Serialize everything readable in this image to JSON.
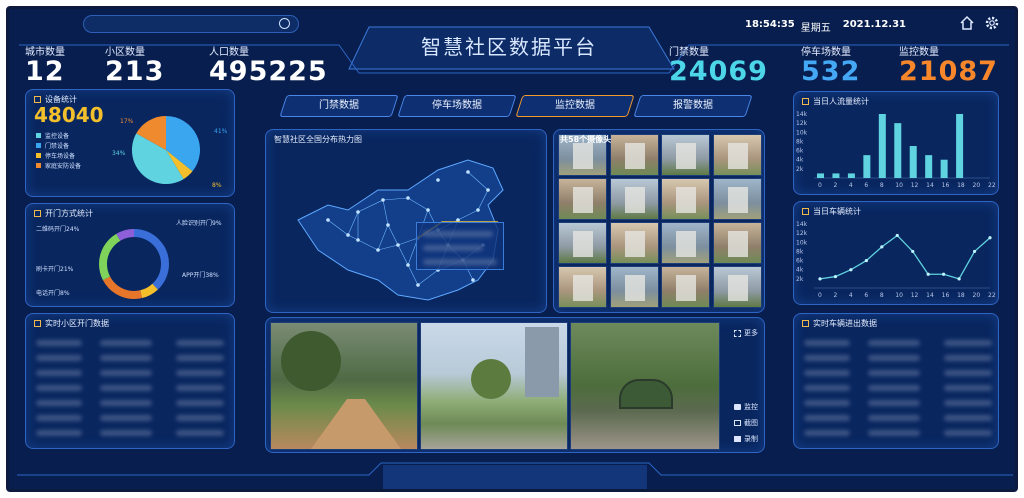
{
  "header": {
    "title": "智慧社区数据平台",
    "time": "18:54:35",
    "weekday": "星期五",
    "date": "2021.12.31"
  },
  "kpis": {
    "city": {
      "label": "城市数量",
      "value": "12"
    },
    "district": {
      "label": "小区数量",
      "value": "213"
    },
    "population": {
      "label": "人口数量",
      "value": "495225"
    },
    "door": {
      "label": "门禁数量",
      "value": "24069",
      "color": "#4cd6e8"
    },
    "parking": {
      "label": "停车场数量",
      "value": "532",
      "color": "#45a8f5"
    },
    "monitor": {
      "label": "监控数量",
      "value": "21087",
      "color": "#f7872a"
    }
  },
  "tabs": [
    "门禁数据",
    "停车场数据",
    "监控数据",
    "报警数据"
  ],
  "device": {
    "title": "设备统计",
    "total": "48040",
    "pct_orange": "17%",
    "pct_blue": "41%",
    "pct_teal": "34%",
    "pct_yellow": "8%",
    "legend": [
      {
        "label": "监控设备",
        "color": "#5fd3e0"
      },
      {
        "label": "门禁设备",
        "color": "#3aa6f0"
      },
      {
        "label": "停车场设备",
        "color": "#f3c02c"
      },
      {
        "label": "家庭安防设备",
        "color": "#f08a2e"
      }
    ]
  },
  "door_method": {
    "title": "开门方式统计",
    "labels": [
      "二维码开门24%",
      "人脸识别开门9%",
      "刷卡开门21%",
      "APP开门38%",
      "电话开门8%"
    ]
  },
  "realtime_door": {
    "title": "实时小区开门数据"
  },
  "map": {
    "title": "智慧社区全国分布热力图"
  },
  "cams": {
    "title": "共58个摄像头"
  },
  "traffic": {
    "title": "当日人流量统计",
    "values": [
      1,
      1,
      1,
      5,
      14,
      12,
      7,
      5,
      4,
      14
    ],
    "xticks": [
      "0",
      "2",
      "4",
      "6",
      "8",
      "10",
      "12",
      "14",
      "16",
      "18",
      "20",
      "22"
    ],
    "yticks": [
      "2k",
      "4k",
      "6k",
      "8k",
      "10k",
      "12k",
      "14k"
    ]
  },
  "vehicle": {
    "title": "当日车辆统计",
    "values": [
      2,
      2.5,
      4,
      6,
      9,
      11.5,
      8,
      3,
      3,
      2,
      8,
      11
    ],
    "xticks": [
      "0",
      "2",
      "4",
      "6",
      "8",
      "10",
      "12",
      "14",
      "16",
      "18",
      "20",
      "22"
    ],
    "yticks": [
      "2k",
      "4k",
      "6k",
      "8k",
      "10k",
      "12k",
      "14k"
    ]
  },
  "vehicle_io": {
    "title": "实时车辆进出数据"
  },
  "side": {
    "more": "更多",
    "a": "监控",
    "b": "截图",
    "c": "录制"
  }
}
